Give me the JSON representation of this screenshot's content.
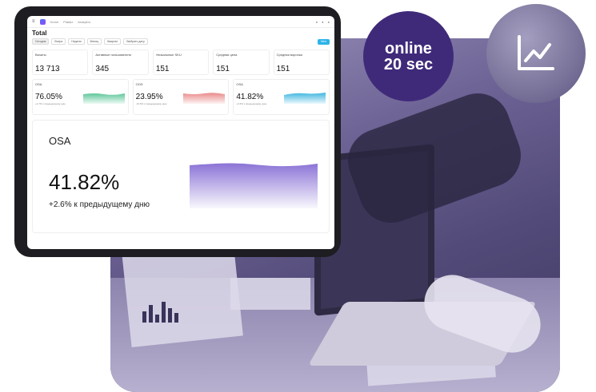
{
  "badges": {
    "online_line1": "online",
    "online_line2": "20 sec",
    "chart_icon": "line-chart-icon"
  },
  "dashboard": {
    "nav": [
      "Home",
      "Plataiz",
      "Analytics"
    ],
    "title": "Total",
    "tabs": [
      "Сегодня",
      "Вчера",
      "Неделя",
      "Месяц",
      "Квартал",
      "Выбрать дату"
    ],
    "new_button": "New",
    "kpis": [
      {
        "label": "Визиты",
        "value": "13 713"
      },
      {
        "label": "Активные пользователи",
        "value": "345"
      },
      {
        "label": "Уникальные SKU",
        "value": "151"
      },
      {
        "label": "Средняя цена",
        "value": "151"
      },
      {
        "label": "Средняя воронка",
        "value": "151"
      }
    ],
    "minis": [
      {
        "label": "OSA",
        "value": "76.05%",
        "sub": "+2.7% к предыдущему дню",
        "color": "#5fc79b"
      },
      {
        "label": "OOS",
        "value": "23.95%",
        "sub": "-19.6% к предыдущему дню",
        "color": "#ea8a8a"
      },
      {
        "label": "OSA",
        "value": "41.82%",
        "sub": "+2.6% к предыдущему дню",
        "color": "#3fb6e0"
      }
    ],
    "big": {
      "label": "OSA",
      "value": "41.82%",
      "sub": "+2.6% к предыдущему дню",
      "color": "#8b73d6"
    }
  }
}
